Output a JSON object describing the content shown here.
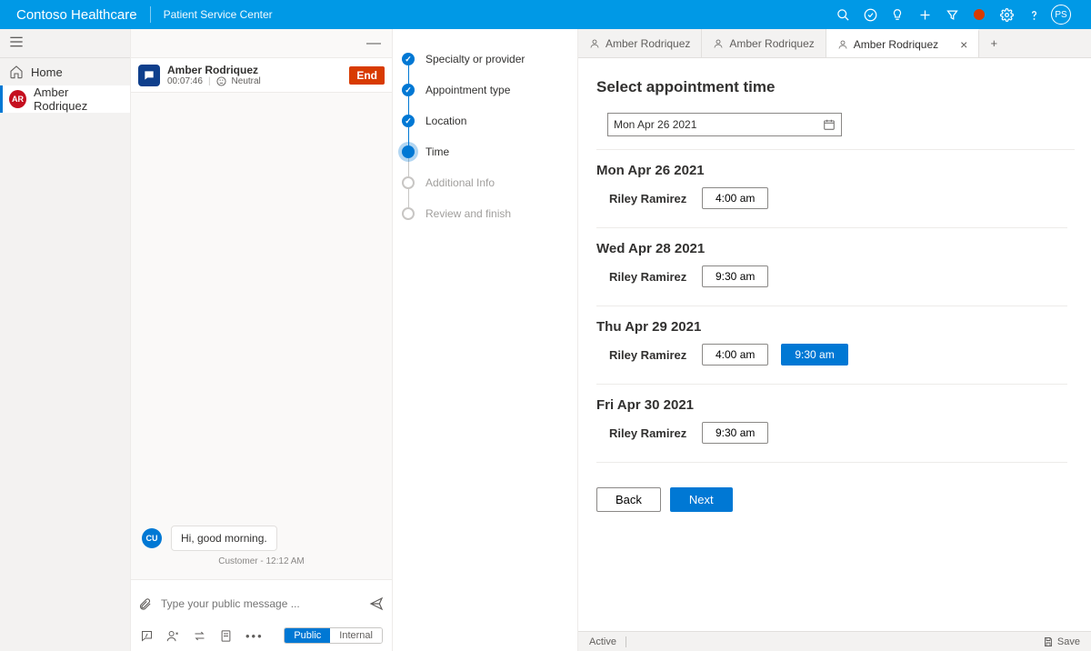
{
  "topbar": {
    "brand": "Contoso Healthcare",
    "sub": "Patient Service Center",
    "persona": "PS"
  },
  "leftnav": {
    "home": "Home",
    "patient_initials": "AR",
    "patient": "Amber Rodriquez"
  },
  "conversation": {
    "name": "Amber Rodriquez",
    "timer": "00:07:46",
    "sentiment": "Neutral",
    "end": "End",
    "msg_avatar": "CU",
    "msg_text": "Hi, good morning.",
    "time_meta": "Customer - 12:12 AM",
    "input_placeholder": "Type your public message ...",
    "pill_public": "Public",
    "pill_internal": "Internal"
  },
  "wizard": {
    "steps": [
      {
        "label": "Specialty or provider",
        "state": "done"
      },
      {
        "label": "Appointment type",
        "state": "done"
      },
      {
        "label": "Location",
        "state": "done"
      },
      {
        "label": "Time",
        "state": "current"
      },
      {
        "label": "Additional Info",
        "state": "pending"
      },
      {
        "label": "Review and finish",
        "state": "pending"
      }
    ]
  },
  "tabs": {
    "t0": "Amber Rodriquez",
    "t1": "Amber Rodriquez",
    "t2": "Amber Rodriquez"
  },
  "content": {
    "title": "Select appointment time",
    "datebox": "Mon Apr 26 2021",
    "days": [
      {
        "title": "Mon Apr 26 2021",
        "provider": "Riley Ramirez",
        "slots": [
          {
            "t": "4:00 am",
            "sel": false
          }
        ]
      },
      {
        "title": "Wed Apr 28 2021",
        "provider": "Riley Ramirez",
        "slots": [
          {
            "t": "9:30 am",
            "sel": false
          }
        ]
      },
      {
        "title": "Thu Apr 29 2021",
        "provider": "Riley Ramirez",
        "slots": [
          {
            "t": "4:00 am",
            "sel": false
          },
          {
            "t": "9:30 am",
            "sel": true
          }
        ]
      },
      {
        "title": "Fri Apr 30 2021",
        "provider": "Riley Ramirez",
        "slots": [
          {
            "t": "9:30 am",
            "sel": false
          }
        ]
      }
    ],
    "back": "Back",
    "next": "Next"
  },
  "statusbar": {
    "status": "Active",
    "save": "Save"
  }
}
